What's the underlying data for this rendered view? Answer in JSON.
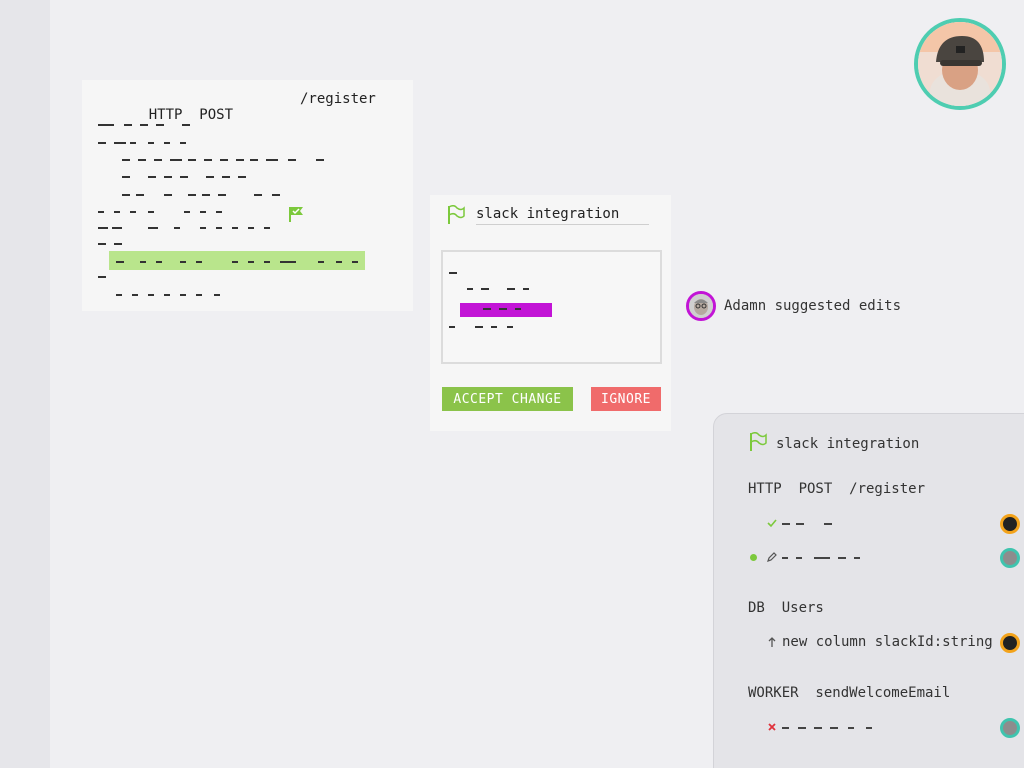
{
  "code_card": {
    "method": "HTTP  POST",
    "path": "/register"
  },
  "suggestion": {
    "title": "slack integration",
    "accept_label": "ACCEPT CHANGE",
    "ignore_label": "IGNORE"
  },
  "notification": {
    "text": "Adamn suggested edits"
  },
  "panel": {
    "title": "slack integration",
    "groups": [
      {
        "header": "HTTP  POST  /register",
        "tasks": [
          {
            "icon": "check-icon",
            "text": "",
            "avatar": "orange"
          },
          {
            "icon": "edit-icon",
            "text": "",
            "avatar": "teal",
            "active": true
          }
        ]
      },
      {
        "header": "DB  Users",
        "tasks": [
          {
            "icon": "arrow-up-icon",
            "text": "new column slackId:string",
            "avatar": "orange"
          }
        ]
      },
      {
        "header": "WORKER  sendWelcomeEmail",
        "tasks": [
          {
            "icon": "close-icon",
            "text": "",
            "avatar": "teal"
          }
        ]
      }
    ]
  },
  "colors": {
    "accent_green": "#8bc34a",
    "highlight_green": "#b9e58c",
    "danger_red": "#f06b6b",
    "purple": "#c214d6",
    "teal": "#4ecdb1",
    "orange": "#f3a31b"
  }
}
